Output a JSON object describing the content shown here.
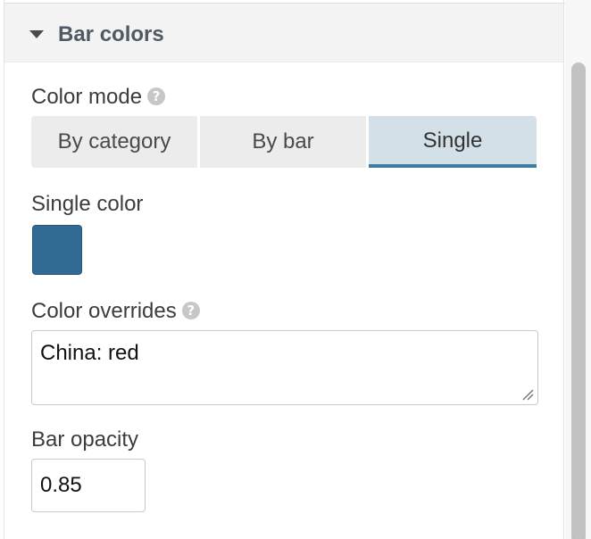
{
  "section": {
    "title": "Bar colors",
    "expanded": true
  },
  "color_mode": {
    "label": "Color mode",
    "help_icon": "question-circle-icon",
    "options": [
      "By category",
      "By bar",
      "Single"
    ],
    "selected": "Single"
  },
  "single_color": {
    "label": "Single color",
    "value": "#336a94"
  },
  "color_overrides": {
    "label": "Color overrides",
    "help_icon": "question-circle-icon",
    "value": "China: red"
  },
  "bar_opacity": {
    "label": "Bar opacity",
    "value": "0.85"
  },
  "colors": {
    "accent": "#3b7ea1",
    "selected_bg": "#d3e0e8",
    "header_bg": "#f3f3f3"
  }
}
